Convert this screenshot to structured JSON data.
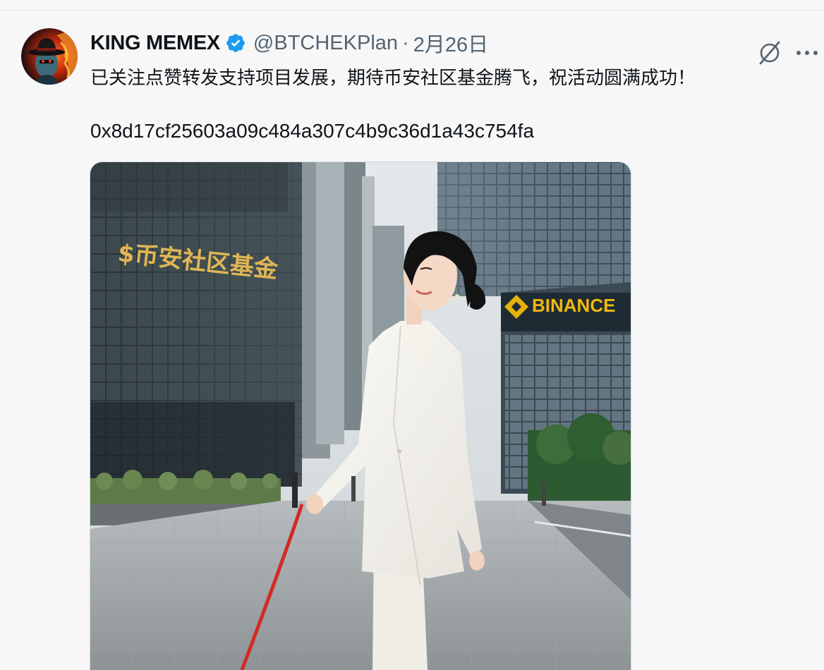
{
  "tweet": {
    "author": {
      "display_name": "KING MEMEX",
      "handle": "@BTCHEKPlan",
      "verified": true,
      "avatar_icon": "avatar-hat-flame"
    },
    "separator": "·",
    "date": "2月26日",
    "body_line1": "已关注点赞转发支持项目发展，期待币安社区基金腾飞，祝活动圆满成功！",
    "body_line2": "0x8d17cf25603a09c484a307c4b9c36d1a43c754fa",
    "media": {
      "building_sign_left": "$币安社区基金",
      "building_sign_right": "BINANCE",
      "description_icon": "photo"
    },
    "actions": {
      "grok_icon": "grok-icon",
      "more_icon": "more-icon"
    },
    "colors": {
      "verified_blue": "#1d9bf0",
      "text_primary": "#0f1419",
      "text_secondary": "#536471"
    }
  }
}
